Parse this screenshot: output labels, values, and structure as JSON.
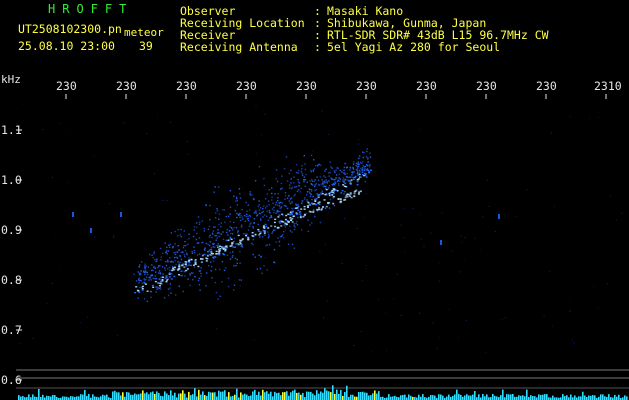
{
  "header": {
    "brand": "HROFFT",
    "filename": "UT2508102300.pn",
    "detection_type": "meteor",
    "datetime": "25.08.10 23:00",
    "count": "39",
    "meta": [
      {
        "label": "Observer",
        "sep": ":",
        "value": "Masaki Kano"
      },
      {
        "label": "Receiving Location",
        "sep": ":",
        "value": "Shibukawa, Gunma, Japan"
      },
      {
        "label": "Receiver",
        "sep": ":",
        "value": "RTL-SDR SDR# 43dB L15 96.7MHz CW"
      },
      {
        "label": "Receiving Antenna",
        "sep": ":",
        "value": "5el Yagi Az 280 for Seoul"
      }
    ]
  },
  "axes": {
    "y_unit": "kHz",
    "y_ticks": [
      "1.1",
      "1.0",
      "0.9",
      "0.8",
      "0.7",
      "0.6"
    ],
    "x_ticks": [
      "230",
      "230",
      "230",
      "230",
      "230",
      "230",
      "230",
      "230",
      "230",
      "2310"
    ]
  },
  "colors": {
    "background": "#000000",
    "header_text": "#ffff44",
    "brand": "#33ee33",
    "axis_text": "#e6e6e6",
    "grid": "#888888",
    "signal": "#2266ff",
    "signal_bright": "#aaddff",
    "amplitude_cyan": "#33ddff",
    "amplitude_yellow": "#ffff33"
  }
}
